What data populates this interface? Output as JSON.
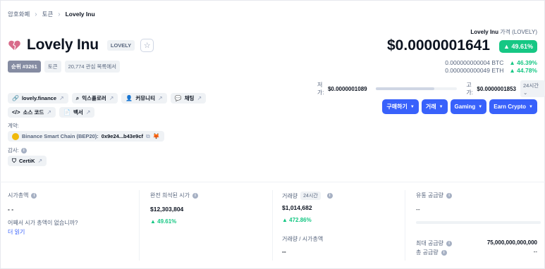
{
  "breadcrumb": [
    "암호화폐",
    "토큰",
    "Lovely Inu"
  ],
  "coin": {
    "name": "Lovely Inu",
    "symbol": "LOVELY",
    "rank": "순위 #3261",
    "type": "토큰",
    "watchlist": "20,774 관심 목록에서"
  },
  "price": {
    "label_name": "Lovely Inu",
    "label_suffix": "가격 (LOVELY)",
    "value": "$0.0000001641",
    "change": "49.61%",
    "btc_value": "0.000000000004 BTC",
    "btc_change": "46.39%",
    "eth_value": "0.000000000049 ETH",
    "eth_change": "44.78%"
  },
  "range": {
    "low_label": "저가:",
    "low_value": "$0.0000001089",
    "high_label": "고가:",
    "high_value": "$0.0000001853",
    "position": 0.72,
    "timeframe": "24시간"
  },
  "links": {
    "website": "lovely.finance",
    "explorer": "익스플로러",
    "community": "커뮤니티",
    "chat": "채팅",
    "source": "소스 코드",
    "whitepaper": "백서"
  },
  "contract": {
    "label": "계약:",
    "chain": "Binance Smart Chain (BEP20):",
    "address": "0x9e24...b43e9cf"
  },
  "audit": {
    "label": "감사:",
    "name": "CertiK"
  },
  "actions": {
    "buy": "구매하기",
    "trade": "거래",
    "gaming": "Gaming",
    "earn": "Earn Crypto"
  },
  "stats": {
    "market_cap": {
      "title": "시가총액",
      "value": "- -",
      "question": "어째서 시가 총액이 없습니까?",
      "link": "더 읽기"
    },
    "fdv": {
      "title": "완전 희석된 시가",
      "value": "$12,303,804",
      "change": "49.61%"
    },
    "volume": {
      "title": "거래량",
      "timeframe": "24시간",
      "value": "$1,014,682",
      "change": "472.86%",
      "ratio_title": "거래량 / 시가총액",
      "ratio_value": "--"
    },
    "supply": {
      "circ_title": "유통 공급량",
      "circ_value": "--",
      "max_title": "최대 공급량",
      "max_value": "75,000,000,000,000",
      "total_title": "총 공급량",
      "total_value": "--"
    }
  },
  "colors": {
    "accent": "#3861fb",
    "up": "#16c784",
    "heart": "#d86b8a"
  }
}
